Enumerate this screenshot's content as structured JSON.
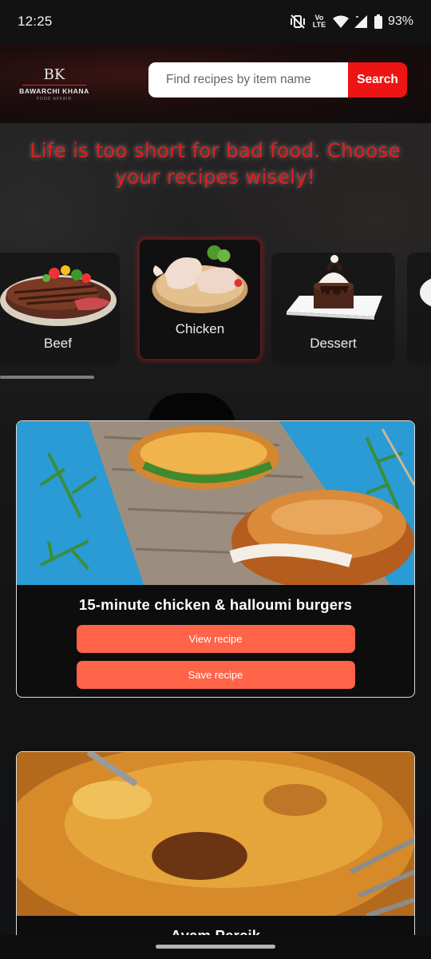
{
  "status_bar": {
    "time": "12:25",
    "network_label": "Vo LTE",
    "battery": "93%"
  },
  "header": {
    "logo_mark": "BK",
    "logo_name": "BAWARCHI KHANA",
    "logo_subtitle": "FOOD AFFAIR",
    "search_placeholder": "Find recipes by item name",
    "search_button": "Search"
  },
  "hero": {
    "tagline_line1": "Life is too short for bad food. Choose",
    "tagline_line2": "your recipes wisely!"
  },
  "categories": [
    {
      "label": "Beef",
      "active": false
    },
    {
      "label": "Chicken",
      "active": true
    },
    {
      "label": "Dessert",
      "active": false
    }
  ],
  "recipes": [
    {
      "title": "15-minute chicken & halloumi burgers",
      "view_label": "View recipe",
      "save_label": "Save recipe"
    },
    {
      "title": "Ayam Percik"
    }
  ],
  "colors": {
    "accent": "#ee1414",
    "button": "#ff6449",
    "tagline": "#e51c1c",
    "background": "#111214"
  }
}
